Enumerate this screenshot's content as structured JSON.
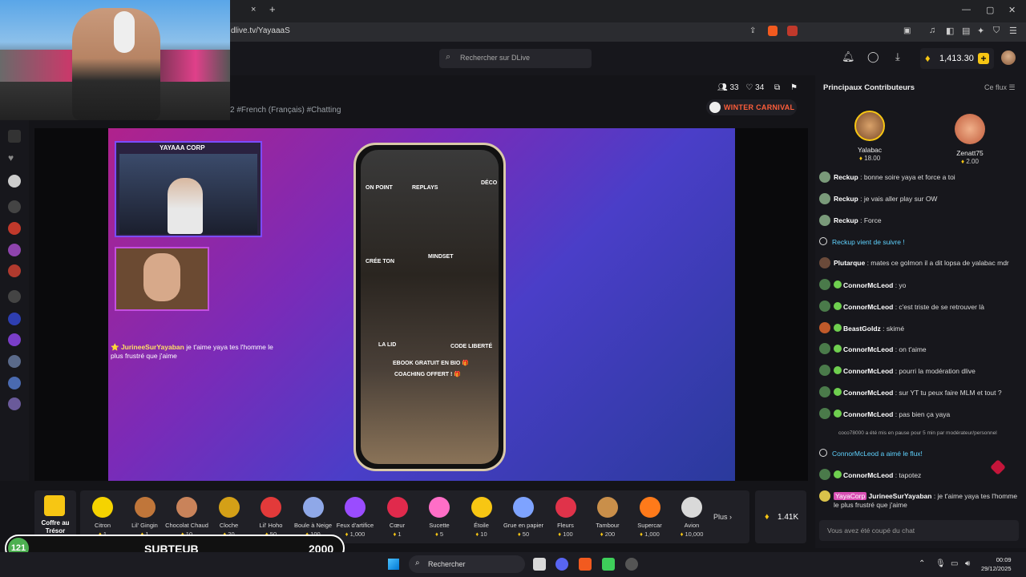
{
  "browser": {
    "url": "dlive.tv/YayaaaS",
    "new_tab": "+",
    "close_tab": "×",
    "win_min": "—",
    "win_max": "▢",
    "win_close": "✕"
  },
  "header": {
    "search_placeholder": "Rechercher sur DLive",
    "balance": "1,413.30",
    "balance_plus": "+"
  },
  "stream": {
    "viewers": "33",
    "likes": "34",
    "tags": "2  #French (Français)  #Chatting",
    "event": "WINTER CARNIVAL"
  },
  "video_overlay": {
    "cam_title": "YAYAAA CORP",
    "chat_user": "⭐ JurineeSurYayaban",
    "chat_text": "je t'aime yaya tes l'homme le plus frustré que j'aime",
    "phone_labels": [
      "ON POINT",
      "REPLAYS",
      "DÉCO",
      "CRÉE TON",
      "MINDSET",
      "LA LID",
      "CODE LIBERTÉ",
      "EBOOK GRATUIT EN BIO 🎁",
      "COACHING OFFERT ! 🎁"
    ]
  },
  "treasure": {
    "label": "Coffre au Trésor"
  },
  "gifts": [
    {
      "name": "Citron",
      "price": "1",
      "color": "#f5d300"
    },
    {
      "name": "Lil' Gingin",
      "price": "1",
      "color": "#c0763a"
    },
    {
      "name": "Chocolat Chaud",
      "price": "10",
      "color": "#c9835a"
    },
    {
      "name": "Cloche",
      "price": "20",
      "color": "#d4a017"
    },
    {
      "name": "Lil' Hoho",
      "price": "50",
      "color": "#e33a3a"
    },
    {
      "name": "Boule à Neige",
      "price": "100",
      "color": "#8fa8e8"
    },
    {
      "name": "Feux d'artifice",
      "price": "1,000",
      "color": "#9a4cff"
    },
    {
      "name": "Cœur",
      "price": "1",
      "color": "#e02a4c"
    },
    {
      "name": "Sucette",
      "price": "5",
      "color": "#ff6ec7"
    },
    {
      "name": "Étoile",
      "price": "10",
      "color": "#f7c613"
    },
    {
      "name": "Grue en papier",
      "price": "50",
      "color": "#7ea3ff"
    },
    {
      "name": "Fleurs",
      "price": "100",
      "color": "#e0334a"
    },
    {
      "name": "Tambour",
      "price": "200",
      "color": "#c98f4a"
    },
    {
      "name": "Supercar",
      "price": "1,000",
      "color": "#ff7a1a"
    },
    {
      "name": "Avion",
      "price": "10,000",
      "color": "#d9d9d9"
    }
  ],
  "gifts_more": "Plus ›",
  "gifts_total": "1.41K",
  "subteub": {
    "count": "121",
    "label": "SUBTEUB",
    "goal": "2000"
  },
  "contributors": {
    "title": "Principaux Contributeurs",
    "scope": "Ce flux",
    "top": [
      {
        "name": "Yalabac",
        "amount": "18.00"
      },
      {
        "name": "Zenatt75",
        "amount": "2.00"
      }
    ]
  },
  "chat": [
    {
      "user": "Reckup",
      "text": "bonne soire yaya et force a toi",
      "badge": false
    },
    {
      "user": "Reckup",
      "text": "je vais aller play sur OW",
      "badge": false
    },
    {
      "user": "Reckup",
      "text": "Force",
      "badge": false
    },
    {
      "system": "Reckup vient de suivre !"
    },
    {
      "user": "Plutarque",
      "text": "mates ce golmon il a dit lopsa de yalabac mdr",
      "badge": false
    },
    {
      "user": "ConnorMcLeod",
      "text": "yo",
      "badge": true
    },
    {
      "user": "ConnorMcLeod",
      "text": "c'est triste de se retrouver là",
      "badge": true
    },
    {
      "user": "BeastGoldz",
      "text": "skimé",
      "badge": true
    },
    {
      "user": "ConnorMcLeod",
      "text": "on t'aime",
      "badge": true
    },
    {
      "user": "ConnorMcLeod",
      "text": "pourri la modération dlive",
      "badge": true
    },
    {
      "user": "ConnorMcLeod",
      "text": "sur YT tu peux faire MLM et tout ?",
      "badge": true
    },
    {
      "user": "ConnorMcLeod",
      "text": "pas bien ça yaya",
      "badge": true
    }
  ],
  "mod_note": "coco78000 a été mis en pause pour 5 min par modérateur/personnel",
  "chat_after": [
    {
      "system": "ConnorMcLeod a aimé le flux!"
    },
    {
      "user": "ConnorMcLeod",
      "text": "tapotez",
      "badge": true
    }
  ],
  "last_chat": {
    "tag": "YayaCorp",
    "user": "JurineeSurYayaban",
    "text": "je t'aime yaya tes l'homme le plus frustré que j'aime"
  },
  "chat_input_placeholder": "Vous avez été coupé du chat",
  "taskbar": {
    "search": "Rechercher",
    "time": "00:09",
    "date": "29/12/2025"
  }
}
